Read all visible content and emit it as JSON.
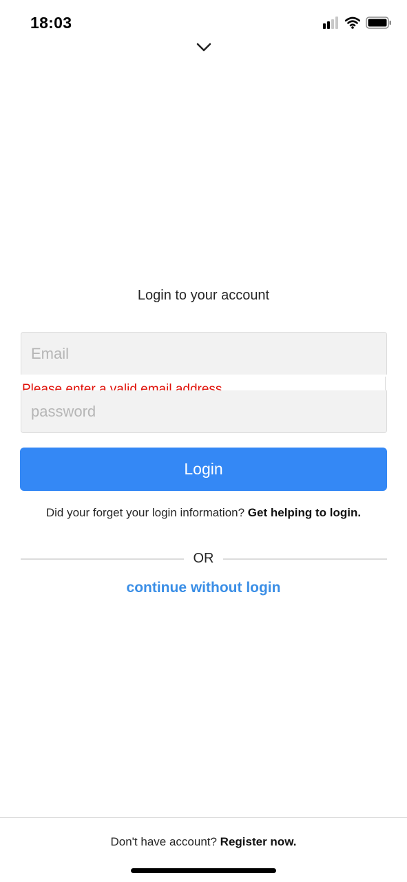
{
  "status_bar": {
    "time": "18:03",
    "icons": [
      "cellular-signal-icon",
      "wifi-icon",
      "battery-icon"
    ]
  },
  "header": {
    "dismiss_icon": "chevron-down-icon"
  },
  "login_form": {
    "title": "Login to your account",
    "email": {
      "value": "",
      "placeholder": "Email",
      "error": "Please enter a valid email address"
    },
    "password": {
      "value": "",
      "placeholder": "password"
    },
    "submit_label": "Login",
    "forgot_prompt": "Did your forget your login information? ",
    "forgot_link": "Get helping to login.",
    "divider_label": "OR",
    "continue_link": "continue without login"
  },
  "footer": {
    "prompt": "Don't have account? ",
    "register_link": "Register now."
  },
  "colors": {
    "primary_button": "#3488f5",
    "link": "#3a8ee6",
    "error": "#e0120a",
    "field_background": "#f2f2f2"
  }
}
